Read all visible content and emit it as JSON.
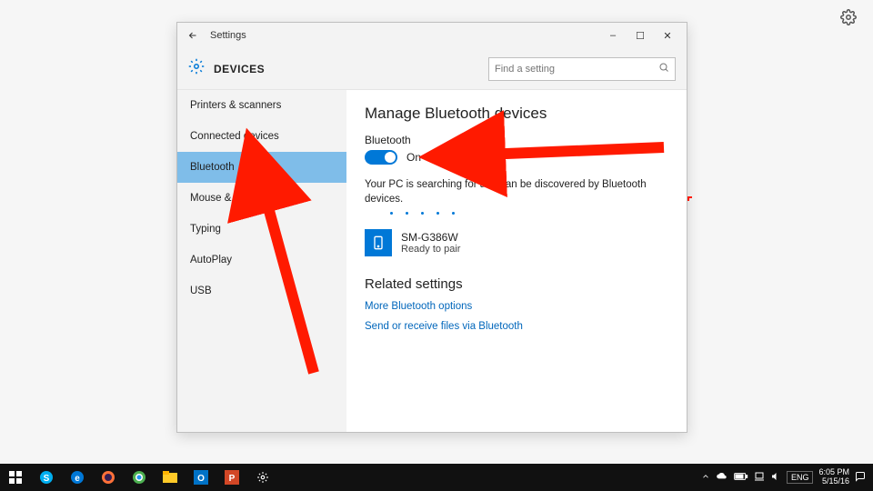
{
  "outer": {
    "gear": "gear-icon"
  },
  "window": {
    "title": "Settings",
    "controls": {
      "min": "–",
      "max": "☐",
      "close": "✕"
    },
    "header": {
      "title": "DEVICES",
      "search_placeholder": "Find a setting"
    }
  },
  "sidebar": {
    "items": [
      {
        "label": "Printers & scanners",
        "selected": false
      },
      {
        "label": "Connected devices",
        "selected": false
      },
      {
        "label": "Bluetooth",
        "selected": true
      },
      {
        "label": "Mouse & touchpad",
        "selected": false
      },
      {
        "label": "Typing",
        "selected": false
      },
      {
        "label": "AutoPlay",
        "selected": false
      },
      {
        "label": "USB",
        "selected": false
      }
    ]
  },
  "content": {
    "heading": "Manage Bluetooth devices",
    "toggle_label": "Bluetooth",
    "toggle_state": "On",
    "status": "Your PC is searching for and can be discovered by Bluetooth devices.",
    "device": {
      "name": "SM-G386W",
      "status": "Ready to pair"
    },
    "related_heading": "Related settings",
    "links": [
      "More Bluetooth options",
      "Send or receive files via Bluetooth"
    ]
  },
  "taskbar": {
    "apps": [
      "start",
      "skype",
      "edge",
      "firefox",
      "chrome",
      "file-explorer",
      "outlook",
      "powerpoint",
      "settings"
    ],
    "tray": {
      "lang": "ENG",
      "time": "6:05 PM",
      "date": "5/15/16"
    }
  },
  "annotations": {
    "arrows": [
      {
        "target": "bluetooth-toggle"
      },
      {
        "target": "sidebar-bluetooth"
      }
    ]
  },
  "colors": {
    "accent": "#0078d7",
    "arrow": "#ff1a00"
  }
}
